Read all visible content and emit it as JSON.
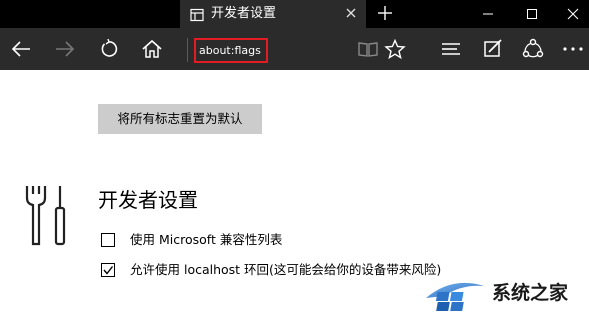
{
  "tab": {
    "title": "开发者设置",
    "icon": "page-icon",
    "close_icon": "close-icon"
  },
  "window_controls": [
    "minimize-icon",
    "maximize-icon",
    "close-icon"
  ],
  "toolbar": {
    "address": "about:flags",
    "address_highlight_color": "#e31c23",
    "left_icons": [
      "back-arrow-icon",
      "forward-arrow-icon",
      "refresh-icon",
      "home-icon"
    ],
    "right_icons": [
      "reading-view-icon",
      "favorite-star-icon",
      "hub-icon",
      "web-note-icon",
      "share-icon",
      "more-icon"
    ]
  },
  "content": {
    "reset_button": "将所有标志重置为默认",
    "section_title": "开发者设置",
    "options": [
      {
        "label": "使用 Microsoft 兼容性列表",
        "checked": false
      },
      {
        "label": "允许使用 localhost 环回(这可能会给你的设备带来风险)",
        "checked": true
      }
    ]
  },
  "watermark": {
    "text": "系统之家"
  },
  "colors": {
    "tab_bar_bg": "#000000",
    "toolbar_bg": "#2b2b2b",
    "button_bg": "#cccccc"
  }
}
